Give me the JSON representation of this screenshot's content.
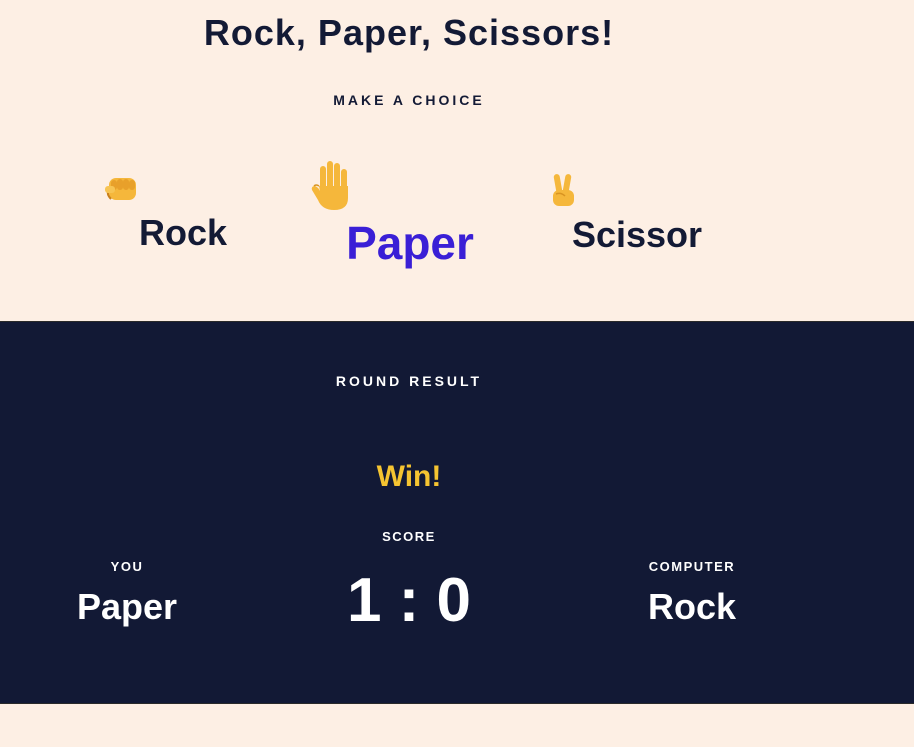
{
  "title": "Rock, Paper, Scissors!",
  "choose": {
    "heading": "MAKE A CHOICE",
    "options": [
      {
        "label": "Rock",
        "icon": "fist-icon"
      },
      {
        "label": "Paper",
        "icon": "hand-icon",
        "selected": true
      },
      {
        "label": "Scissor",
        "icon": "victory-hand-icon"
      }
    ],
    "selected_color": "#3a1fd6"
  },
  "result": {
    "heading": "ROUND RESULT",
    "outcome": "Win!",
    "outcome_color": "#f5c431",
    "score_label": "SCORE",
    "score": "1 : 0",
    "player": {
      "label": "YOU",
      "pick": "Paper"
    },
    "computer": {
      "label": "COMPUTER",
      "pick": "Rock"
    }
  },
  "colors": {
    "background": "#fdefe4",
    "panel": "#121935",
    "text_dark": "#131a35"
  }
}
